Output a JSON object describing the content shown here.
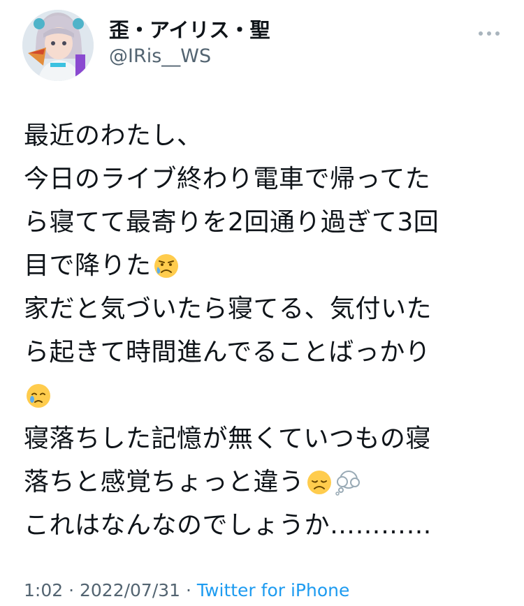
{
  "tweet": {
    "display_name": "歪・アイリス・聖",
    "handle": "@IRis__WS",
    "more_icon": "more-horizontal-icon",
    "lines": [
      "最近のわたし、",
      "今日のライブ終わり電車で帰ってた",
      "ら寝てて最寄りを2回通り過ぎて3回",
      "目で降りた",
      "家だと気づいたら寝てる、気付いた",
      "ら起きて時間進んでることばっかり",
      "",
      "寝落ちした記憶が無くていつもの寝",
      "落ちと感覚ちょっと違う",
      "これはなんなのでしょうか…………"
    ],
    "emojis": {
      "line4": "sad-but-relieved-face-emoji",
      "line7": "face-holding-back-tears-emoji",
      "line9a": "disappointed-face-emoji",
      "line9b": "thought-balloon-emoji"
    },
    "time": "1:02",
    "separator1": " · ",
    "date": "2022/07/31",
    "separator2": " · ",
    "source": "Twitter for iPhone",
    "colors": {
      "text": "#0f1419",
      "secondary": "#536471",
      "link": "#1d9bf0"
    }
  }
}
